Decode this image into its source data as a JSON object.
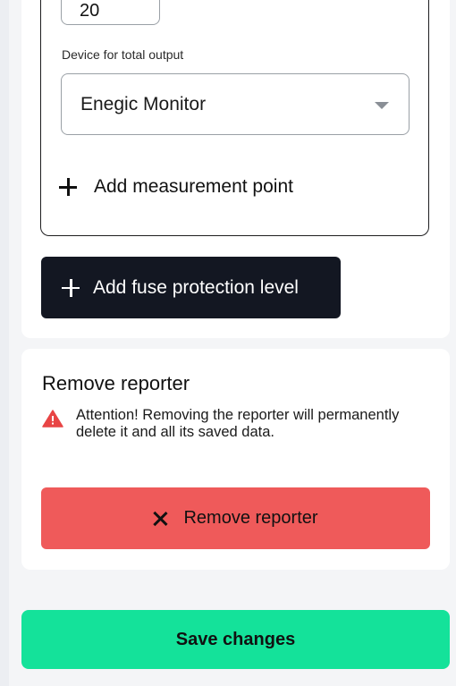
{
  "measurement": {
    "current_value": "20",
    "device_label": "Device for total output",
    "device_selected": "Enegic Monitor",
    "add_point_label": "Add measurement point"
  },
  "fuse": {
    "add_label": "Add fuse protection level"
  },
  "remove_section": {
    "title": "Remove reporter",
    "warning": "Attention! Removing the reporter will permanently delete it and all its saved data.",
    "button_label": "Remove reporter"
  },
  "footer": {
    "save_label": "Save changes"
  },
  "colors": {
    "danger": "#ef5a5a",
    "primary_dark": "#131722",
    "save": "#14e29a",
    "warning_icon": "#e84545"
  },
  "icons": [
    "plus-icon",
    "chevron-down-icon",
    "warning-icon",
    "close-icon"
  ]
}
